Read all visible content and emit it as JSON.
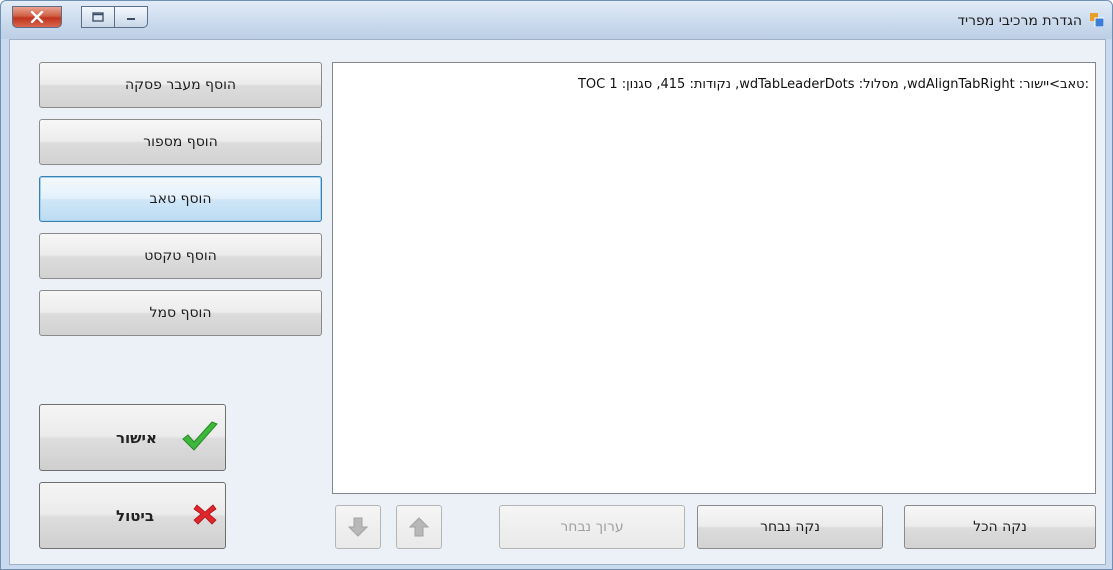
{
  "window": {
    "title": "הגדרת מרכיבי מפריד",
    "app_icon": "app-window-icon",
    "controls": {
      "close": "close-icon",
      "maximize": "maximize-icon",
      "minimize": "minimize-icon"
    }
  },
  "left_panel": {
    "buttons": [
      {
        "label": "הוסף מעבר פסקה"
      },
      {
        "label": "הוסף מספור"
      },
      {
        "label": "הוסף טאב"
      },
      {
        "label": "הוסף טקסט"
      },
      {
        "label": "הוסף סמל"
      }
    ],
    "ok": {
      "label": "אישור",
      "icon": "green-checkmark-icon"
    },
    "cancel": {
      "label": "ביטול",
      "icon": "red-x-icon"
    }
  },
  "list": {
    "items": [
      ":טאב>יישור: wdAlignTabRight, מסלול: wdTabLeaderDots, נקודות: 415, סגנון: TOC 1"
    ]
  },
  "bottom_bar": {
    "move_down_icon": "arrow-down-icon",
    "move_up_icon": "arrow-up-icon",
    "edit_selected": "ערוך נבחר",
    "clear_selected": "נקה נבחר",
    "clear_all": "נקה הכל"
  },
  "colors": {
    "focus_border": "#3c7fb1",
    "ok_icon": "#3cb83a",
    "cancel_icon": "#e0262b"
  }
}
